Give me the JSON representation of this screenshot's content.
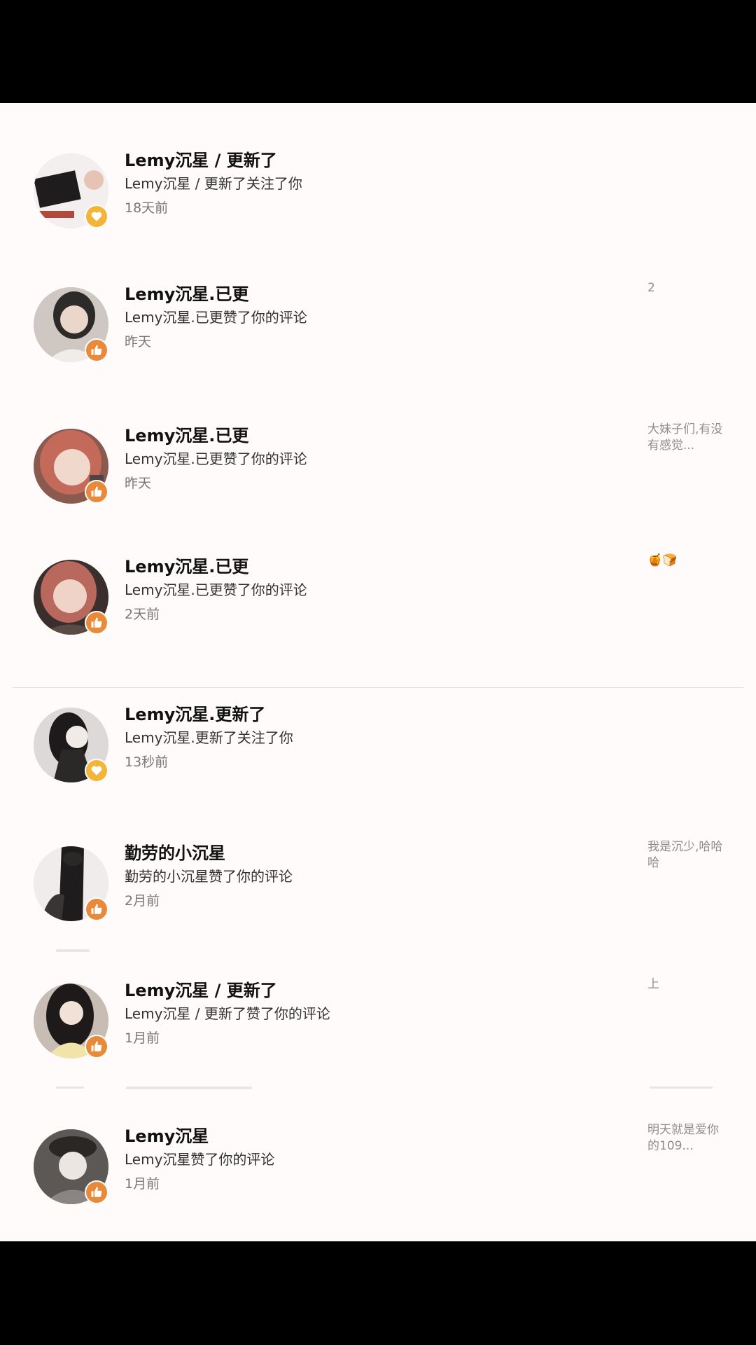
{
  "notifications": [
    {
      "name": "Lemy沉星 / 更新了",
      "desc": "Lemy沉星 / 更新了关注了你",
      "time": "18天前",
      "type": "follow",
      "badge_icon": "heart-icon",
      "snippet": ""
    },
    {
      "name": "Lemy沉星.已更",
      "desc": "Lemy沉星.已更赞了你的评论",
      "time": "昨天",
      "type": "like",
      "badge_icon": "thumbs-up-icon",
      "snippet": "2"
    },
    {
      "name": "Lemy沉星.已更",
      "desc": "Lemy沉星.已更赞了你的评论",
      "time": "昨天",
      "type": "like",
      "badge_icon": "thumbs-up-icon",
      "snippet": "大妹子们,有没有感觉..."
    },
    {
      "name": "Lemy沉星.已更",
      "desc": "Lemy沉星.已更赞了你的评论",
      "time": "2天前",
      "type": "like",
      "badge_icon": "thumbs-up-icon",
      "snippet": "🍯🍞"
    },
    {
      "name": "Lemy沉星.更新了",
      "desc": "Lemy沉星.更新了关注了你",
      "time": "13秒前",
      "type": "follow",
      "badge_icon": "heart-icon",
      "snippet": ""
    },
    {
      "name": "勤劳的小沉星",
      "desc": "勤劳的小沉星赞了你的评论",
      "time": "2月前",
      "type": "like",
      "badge_icon": "thumbs-up-icon",
      "snippet": "我是沉少,哈哈哈"
    },
    {
      "name": "Lemy沉星 / 更新了",
      "desc": "Lemy沉星 / 更新了赞了你的评论",
      "time": "1月前",
      "type": "like",
      "badge_icon": "thumbs-up-icon",
      "snippet": "上"
    },
    {
      "name": "Lemy沉星",
      "desc": "Lemy沉星赞了你的评论",
      "time": "1月前",
      "type": "like",
      "badge_icon": "thumbs-up-icon",
      "snippet": "明天就是爱你的109..."
    }
  ],
  "colors": {
    "background": "#fffbfb",
    "like_badge": "#e98a3b",
    "follow_badge": "#f2b53a"
  }
}
